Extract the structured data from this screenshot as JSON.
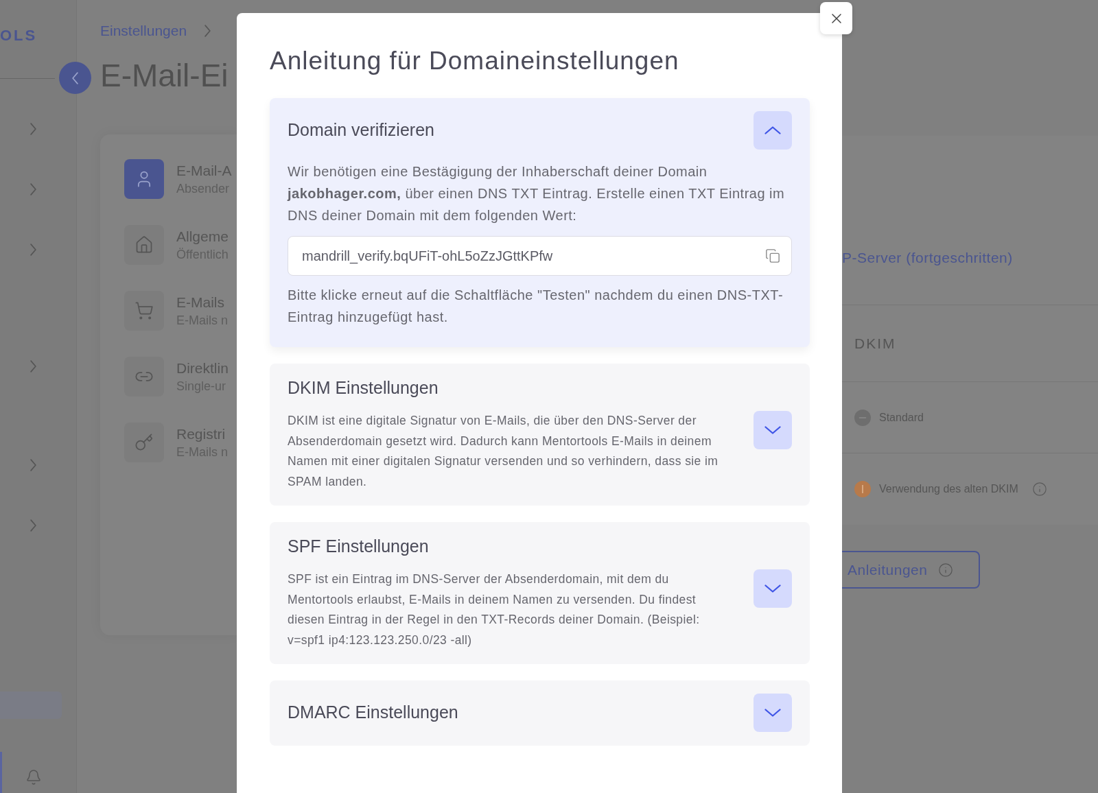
{
  "sidebar": {
    "logo": "OLS"
  },
  "breadcrumb": [
    "Einstellungen"
  ],
  "page_title": "E-Mail-Ei",
  "settings_menu": [
    {
      "title": "E-Mail-A",
      "subtitle": "Absender",
      "kind": "user",
      "selected": true
    },
    {
      "title": "Allgeme",
      "subtitle": "Öffentlich",
      "kind": "home",
      "selected": false
    },
    {
      "title": "E-Mails",
      "subtitle": "E-Mails n",
      "kind": "cart",
      "selected": false
    },
    {
      "title": "Direktlin",
      "subtitle": "Single-ur",
      "kind": "link",
      "selected": false
    },
    {
      "title": "Registri",
      "subtitle": "E-Mails n",
      "kind": "key",
      "selected": false
    }
  ],
  "right_panel": {
    "tab": "P-Server (fortgeschritten)",
    "column_header": "DKIM",
    "rows": [
      {
        "label": "Standard",
        "kind": "neutral",
        "color": "#6e6e6e",
        "info": false
      },
      {
        "label": "Verwendung des alten DKIM",
        "kind": "warning",
        "color": "#b87a4a",
        "info": true
      }
    ],
    "guide_button": "Anleitungen"
  },
  "modal": {
    "title": "Anleitung für Domaineinstellungen",
    "sections": [
      {
        "title": "Domain verifizieren",
        "expanded": true,
        "body": "Wir benötigen eine Bestägigung der Inhaberschaft deiner Domain **jakobhager.com,** über einen DNS TXT Eintrag. Erstelle einen TXT Eintrag im DNS deiner Domain mit dem folgenden Wert:",
        "value": "mandrill_verify.bqUFiT-ohL5oZzJGttKPfw",
        "note": "Bitte klicke erneut auf die Schaltfläche \"Testen\" nachdem du einen DNS-TXT-Eintrag hinzugefügt hast."
      },
      {
        "title": "DKIM Einstellungen",
        "expanded": false,
        "body": "DKIM ist eine digitale Signatur von E-Mails, die über den DNS-Server der Absenderdomain gesetzt wird. Dadurch kann Mentortools E-Mails in deinem Namen mit einer digitalen Signatur versenden und so verhindern, dass sie im SPAM landen."
      },
      {
        "title": "SPF Einstellungen",
        "expanded": false,
        "body": "SPF ist ein Eintrag im DNS-Server der Absenderdomain, mit dem du Mentortools erlaubst, E-Mails in deinem Namen zu versenden. Du findest diesen Eintrag in der Regel in den TXT-Records deiner Domain. (Beispiel: v=spf1 ip4:123.123.250.0/23 -all)"
      },
      {
        "title": "DMARC Einstellungen",
        "expanded": false
      }
    ]
  }
}
